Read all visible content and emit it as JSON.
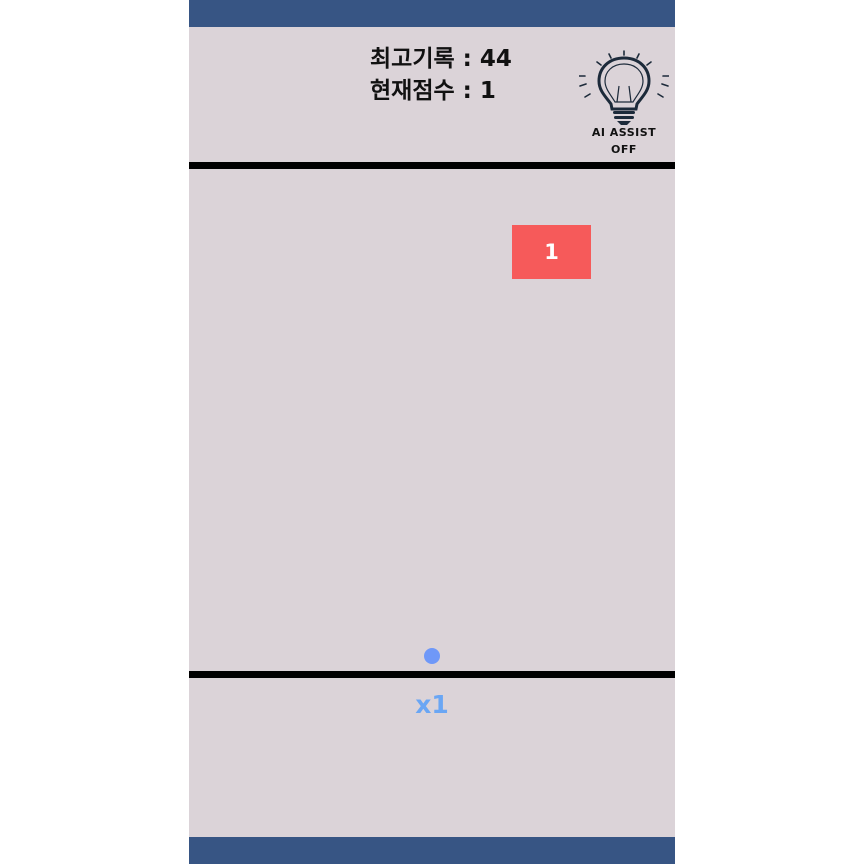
{
  "hud": {
    "best_label": "최고기록",
    "best_value": "44",
    "best_text": "최고기록 : 44",
    "current_label": "현재점수",
    "current_value": "1",
    "current_text": "현재점수 : 1"
  },
  "ai_assist": {
    "title": "AI ASSIST",
    "state": "OFF",
    "icon": "lightbulb-icon"
  },
  "board": {
    "blocks": [
      {
        "value": "1",
        "color": "#f65a5a"
      }
    ],
    "ball": {
      "color": "#6f98f8"
    },
    "ball_multiplier": "x1",
    "multiplier_color": "#6aa6f4"
  },
  "colors": {
    "frame_bar": "#375584",
    "background": "#dbd3d8",
    "divider": "#000000"
  }
}
